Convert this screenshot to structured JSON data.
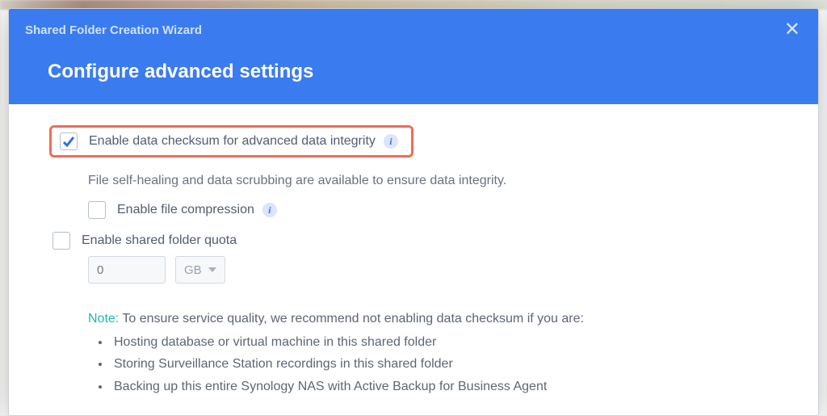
{
  "header": {
    "title": "Shared Folder Creation Wizard",
    "subtitle": "Configure advanced settings"
  },
  "options": {
    "checksum": {
      "label": "Enable data checksum for advanced data integrity",
      "checked": true,
      "description": "File self-healing and data scrubbing are available to ensure data integrity."
    },
    "compression": {
      "label": "Enable file compression",
      "checked": false
    },
    "quota": {
      "label": "Enable shared folder quota",
      "checked": false,
      "value": "0",
      "unit": "GB"
    }
  },
  "note": {
    "label": "Note:",
    "intro": "To ensure service quality, we recommend not enabling data checksum if you are:",
    "items": [
      "Hosting database or virtual machine in this shared folder",
      "Storing Surveillance Station recordings in this shared folder",
      "Backing up this entire Synology NAS with Active Backup for Business Agent"
    ]
  }
}
